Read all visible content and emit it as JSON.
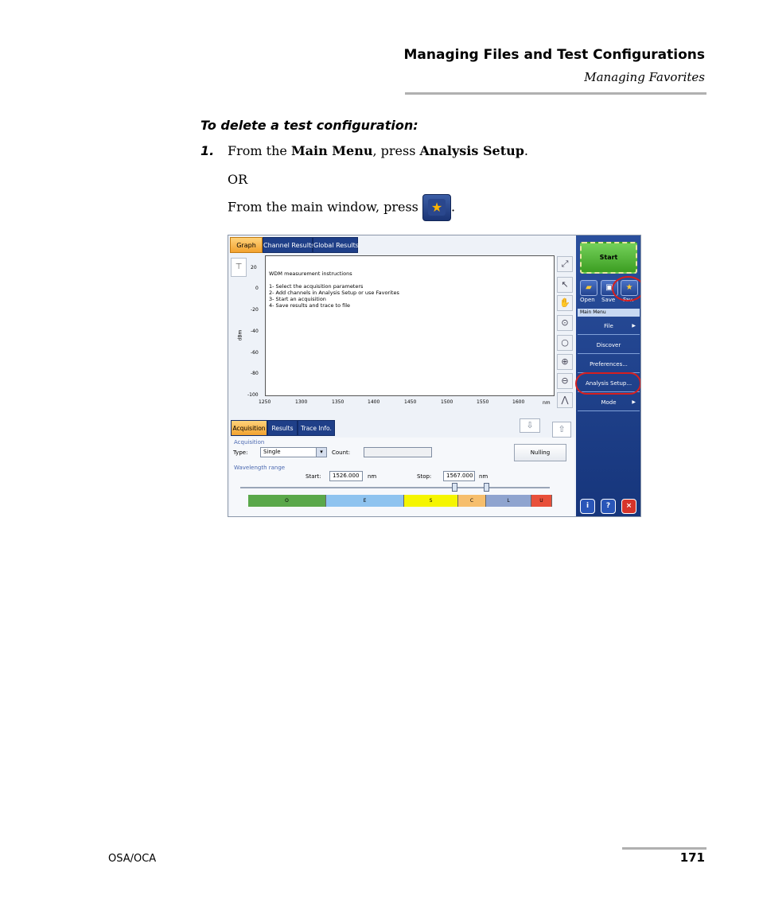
{
  "header": {
    "title": "Managing Files and Test Configurations",
    "subtitle": "Managing Favorites"
  },
  "procedure": {
    "title": "To delete a test configuration:",
    "step_number": "1.",
    "step_prefix": "From the ",
    "step_bold1": "Main Menu",
    "step_middle": ", press ",
    "step_bold2": "Analysis Setup",
    "step_end": ".",
    "or": "OR",
    "alt_text": "From the main window, press",
    "alt_end": "."
  },
  "footer": {
    "left": "OSA/OCA",
    "page_number": "171"
  },
  "screenshot": {
    "tabs": [
      "Graph",
      "Channel Results",
      "Global Results"
    ],
    "plot": {
      "y_ticks": [
        "20",
        "0",
        "-20",
        "-40",
        "-60",
        "-80",
        "-100"
      ],
      "x_ticks": [
        "1250",
        "1300",
        "1350",
        "1400",
        "1450",
        "1500",
        "1550",
        "1600"
      ],
      "x_unit": "nm",
      "y_unit": "dBm",
      "instructions_title": "WDM measurement instructions",
      "instructions": [
        "1- Select the acquisition parameters",
        "2- Add channels in Analysis Setup or use Favorites",
        "3- Start an acquisition",
        "4- Save results and trace to file"
      ]
    },
    "sidebar": {
      "start": "Start",
      "open": "Open",
      "save": "Save",
      "fav": "Fav.",
      "main_menu": "Main Menu",
      "menu_items": [
        "File",
        "Discover",
        "Preferences...",
        "Analysis Setup...",
        "Mode"
      ]
    },
    "bottom_tabs": [
      "Acquisition",
      "Results",
      "Trace Info."
    ],
    "acquisition": {
      "group": "Acquisition",
      "type_label": "Type:",
      "type_value": "Single",
      "count_label": "Count:",
      "nulling": "Nulling"
    },
    "wavelength": {
      "group": "Wavelength range",
      "start_label": "Start:",
      "start_value": "1526.000",
      "stop_label": "Stop:",
      "stop_value": "1567.000",
      "unit": "nm"
    },
    "bands": [
      {
        "label": "O",
        "color": "#5aa84a"
      },
      {
        "label": "E",
        "color": "#8ec3ef"
      },
      {
        "label": "S",
        "color": "#f5f500"
      },
      {
        "label": "C",
        "color": "#f6be6c"
      },
      {
        "label": "L",
        "color": "#8fa4cf"
      },
      {
        "label": "U",
        "color": "#e8503a"
      }
    ]
  }
}
